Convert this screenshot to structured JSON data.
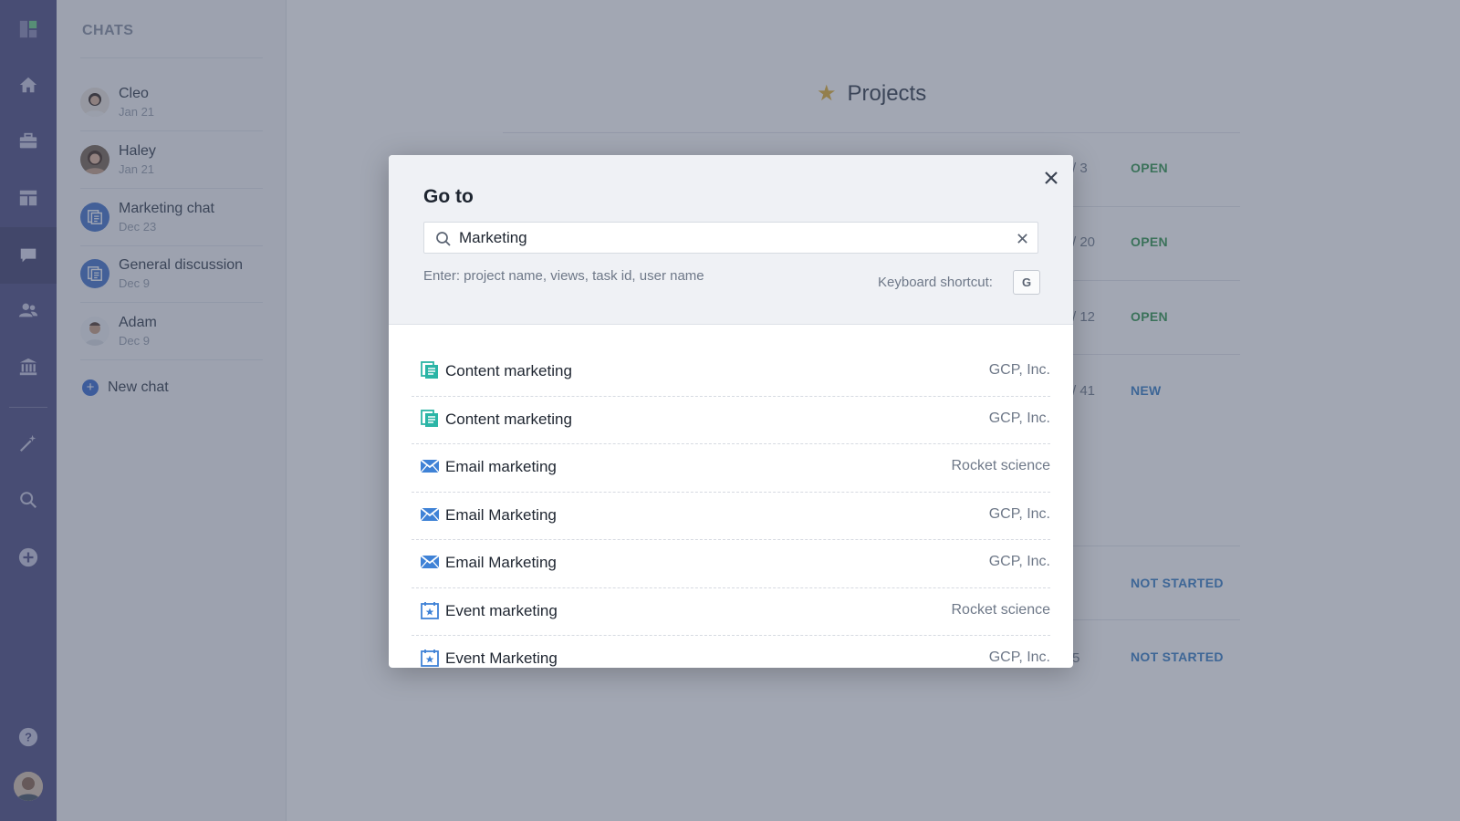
{
  "rail": {
    "icons": [
      "logo-icon",
      "home-icon",
      "briefcase-icon",
      "dashboard-icon",
      "chat-icon",
      "people-icon",
      "bank-icon",
      "magic-wand-icon",
      "search-icon",
      "add-icon",
      "help-icon"
    ],
    "active": "chat-icon"
  },
  "chats": {
    "title": "CHATS",
    "items": [
      {
        "name": "Cleo",
        "date": "Jan 21",
        "avatar": "person"
      },
      {
        "name": "Haley",
        "date": "Jan 21",
        "avatar": "person"
      },
      {
        "name": "Marketing chat",
        "date": "Dec 23",
        "avatar": "group"
      },
      {
        "name": "General discussion",
        "date": "Dec 9",
        "avatar": "group"
      },
      {
        "name": "Adam",
        "date": "Dec 9",
        "avatar": "person"
      }
    ],
    "new_chat": "New chat"
  },
  "main": {
    "title": "Projects",
    "rows": [
      {
        "count": "/ 3",
        "status": "OPEN"
      },
      {
        "count": "/ 20",
        "status": "OPEN"
      },
      {
        "count": "/ 12",
        "status": "OPEN"
      },
      {
        "count": "/ 41",
        "status": "NEW"
      },
      {
        "count": "",
        "status": "NOT STARTED"
      },
      {
        "count": "5",
        "status": "NOT STARTED"
      }
    ],
    "status_colors": {
      "OPEN": "#3a9a55",
      "NEW": "#3f82c8",
      "NOT STARTED": "#3f82c8"
    }
  },
  "modal": {
    "title": "Go to",
    "search": {
      "value": "Marketing",
      "placeholder": ""
    },
    "hint": "Enter: project name, views, task id, user name",
    "shortcut_label": "Keyboard shortcut:",
    "shortcut_key": "G",
    "results": [
      {
        "name": "Content marketing",
        "org": "GCP, Inc.",
        "icon": "content-icon"
      },
      {
        "name": "Content marketing",
        "org": "GCP, Inc.",
        "icon": "content-icon"
      },
      {
        "name": "Email marketing",
        "org": "Rocket science",
        "icon": "email-icon"
      },
      {
        "name": "Email Marketing",
        "org": "GCP, Inc.",
        "icon": "email-icon"
      },
      {
        "name": "Email Marketing",
        "org": "GCP, Inc.",
        "icon": "email-icon"
      },
      {
        "name": "Event marketing",
        "org": "Rocket science",
        "icon": "event-icon"
      },
      {
        "name": "Event Marketing",
        "org": "GCP, Inc.",
        "icon": "event-icon"
      }
    ]
  },
  "colors": {
    "rail": "#545487",
    "accent": "#3f6fd1",
    "content_icon": "#2bb5a6",
    "email_icon": "#3f82d6"
  }
}
